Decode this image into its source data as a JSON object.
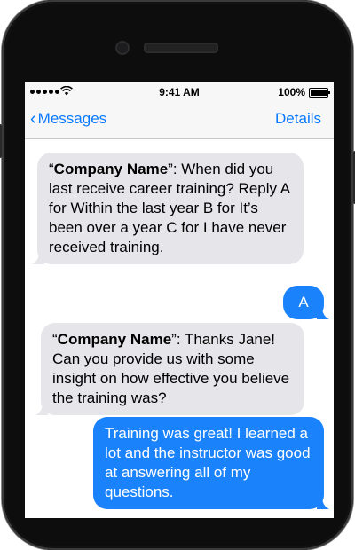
{
  "status": {
    "time": "9:41 AM",
    "battery": "100%"
  },
  "nav": {
    "back_label": "Messages",
    "details_label": "Details"
  },
  "messages": [
    {
      "sender_name": "Company Name",
      "open_quote": "“",
      "close_quote": "”",
      "text": ": When did you last receive career training? Reply A for Within the last year B for It’s been over a year C for I have never received training."
    },
    {
      "text": "A"
    },
    {
      "sender_name": "Company Name",
      "open_quote": "“",
      "close_quote": "”",
      "text": ": Thanks Jane! Can you provide us with some insight on how effective you believe the training was?"
    },
    {
      "text": "Training was great! I learned a lot and the instructor was good at answering all of my questions."
    }
  ],
  "colors": {
    "accent": "#0a7aff",
    "outgoing_bubble": "#1a82fb",
    "incoming_bubble": "#e5e5ea"
  }
}
